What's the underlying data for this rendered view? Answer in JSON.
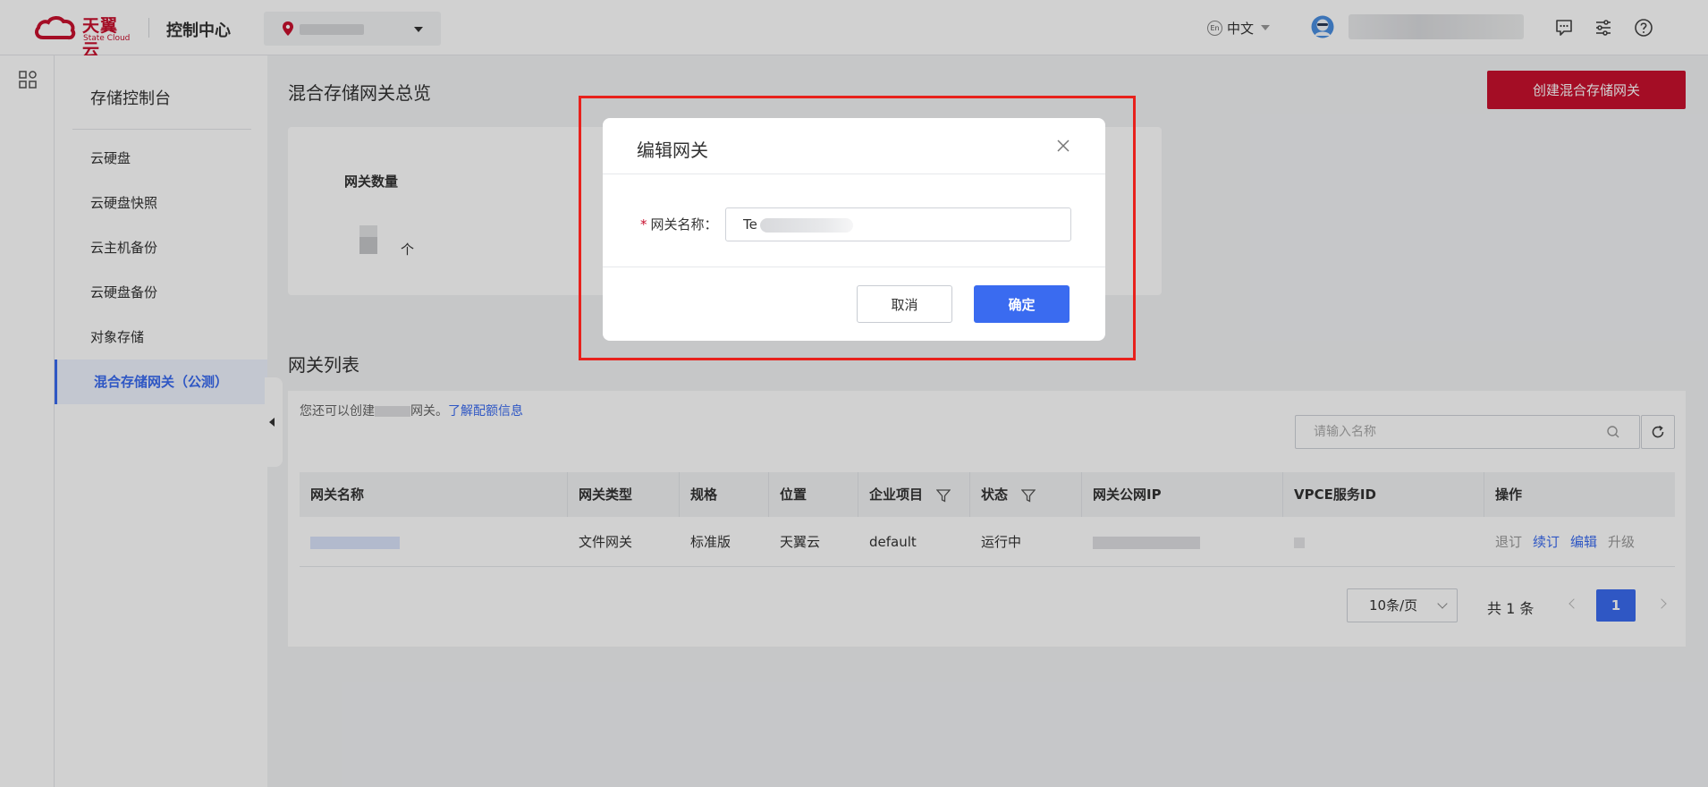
{
  "header": {
    "logo_cn": "天翼云",
    "logo_en": "State Cloud",
    "console_title": "控制中心",
    "language": "中文",
    "language_icon": "En",
    "icons": [
      "message-icon",
      "settings-sliders-icon",
      "help-icon"
    ]
  },
  "sidebar": {
    "title": "存储控制台",
    "items": [
      {
        "label": "云硬盘",
        "active": false
      },
      {
        "label": "云硬盘快照",
        "active": false
      },
      {
        "label": "云主机备份",
        "active": false
      },
      {
        "label": "云硬盘备份",
        "active": false
      },
      {
        "label": "对象存储",
        "active": false
      },
      {
        "label": "混合存储网关（公测）",
        "active": true
      }
    ]
  },
  "main": {
    "title": "混合存储网关总览",
    "create_button": "创建混合存储网关",
    "overview": {
      "label": "网关数量",
      "unit": "个"
    },
    "list": {
      "title": "网关列表",
      "quota_prefix": "您还可以创建",
      "quota_suffix": "网关。",
      "quota_link": "了解配额信息",
      "search_placeholder": "请输入名称",
      "columns": [
        "网关名称",
        "网关类型",
        "规格",
        "位置",
        "企业项目",
        "状态",
        "网关公网IP",
        "VPCE服务ID",
        "操作"
      ],
      "rows": [
        {
          "type": "文件网关",
          "spec": "标准版",
          "location": "天翼云",
          "project": "default",
          "status": "运行中",
          "actions": [
            "退订",
            "续订",
            "编辑",
            "升级"
          ]
        }
      ]
    },
    "pagination": {
      "page_size": "10条/页",
      "total": "共 1 条",
      "current_page": "1"
    }
  },
  "modal": {
    "title": "编辑网关",
    "field_label": "网关名称：",
    "field_value": "Te",
    "cancel": "取消",
    "confirm": "确定"
  },
  "colors": {
    "brand_red": "#c8102e",
    "primary_blue": "#3a6bf0",
    "highlight_red": "#e8211c"
  }
}
